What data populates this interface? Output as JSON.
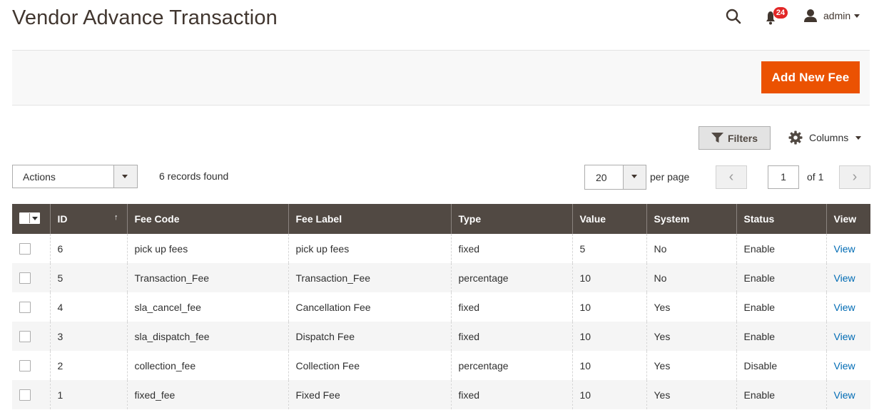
{
  "header": {
    "title": "Vendor Advance Transaction",
    "notifications_count": "24",
    "user_name": "admin"
  },
  "toolbar": {
    "add_button": "Add New Fee",
    "filters_label": "Filters",
    "columns_label": "Columns",
    "actions_label": "Actions",
    "records_found": "6 records found",
    "per_page_value": "20",
    "per_page_label": "per page",
    "page_value": "1",
    "of_pages": "of 1"
  },
  "grid": {
    "columns": [
      "ID",
      "Fee Code",
      "Fee Label",
      "Type",
      "Value",
      "System",
      "Status",
      "View"
    ],
    "sort_indicator": "↑",
    "rows": [
      {
        "id": "6",
        "code": "pick up fees",
        "label": "pick up fees",
        "type": "fixed",
        "value": "5",
        "system": "No",
        "status": "Enable",
        "view": "View"
      },
      {
        "id": "5",
        "code": "Transaction_Fee",
        "label": "Transaction_Fee",
        "type": "percentage",
        "value": "10",
        "system": "No",
        "status": "Enable",
        "view": "View"
      },
      {
        "id": "4",
        "code": "sla_cancel_fee",
        "label": "Cancellation Fee",
        "type": "fixed",
        "value": "10",
        "system": "Yes",
        "status": "Enable",
        "view": "View"
      },
      {
        "id": "3",
        "code": "sla_dispatch_fee",
        "label": "Dispatch Fee",
        "type": "fixed",
        "value": "10",
        "system": "Yes",
        "status": "Enable",
        "view": "View"
      },
      {
        "id": "2",
        "code": "collection_fee",
        "label": "Collection Fee",
        "type": "percentage",
        "value": "10",
        "system": "Yes",
        "status": "Disable",
        "view": "View"
      },
      {
        "id": "1",
        "code": "fixed_fee",
        "label": "Fixed Fee",
        "type": "fixed",
        "value": "10",
        "system": "Yes",
        "status": "Enable",
        "view": "View"
      }
    ]
  },
  "colors": {
    "accent": "#eb5202",
    "header_bg": "#514943",
    "link": "#006bb4",
    "badge": "#e22626"
  }
}
